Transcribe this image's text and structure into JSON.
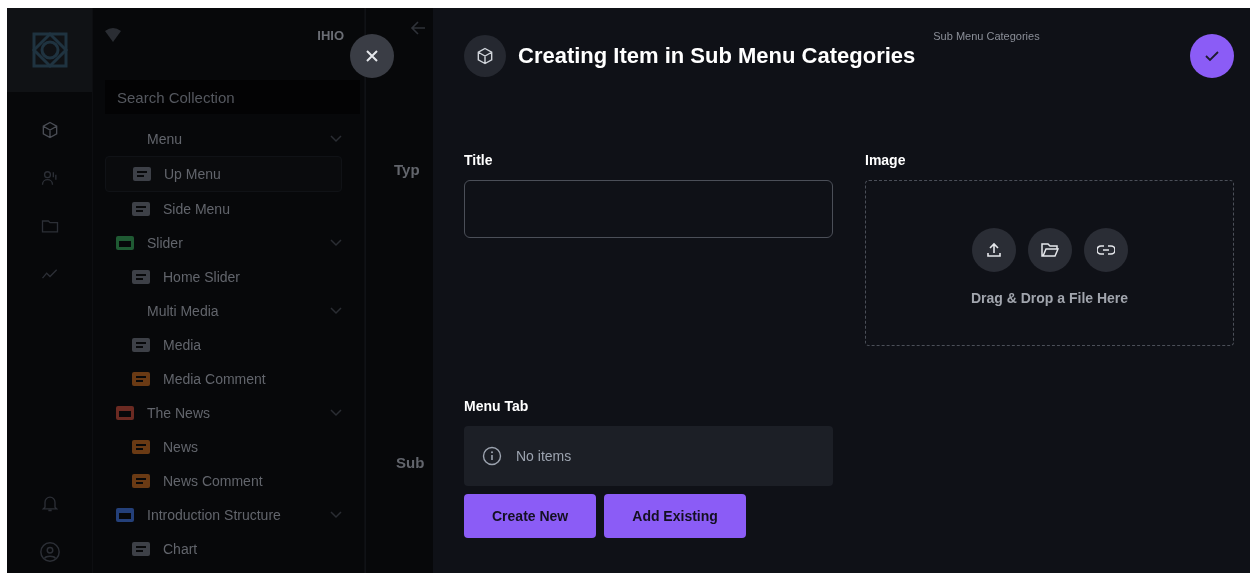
{
  "background": {
    "brand": "IHIO",
    "search": {
      "placeholder": "Search Collection"
    },
    "sidebar": [
      {
        "label": "Menu",
        "expanded": true,
        "children": [
          {
            "label": "Up Menu",
            "selected": true,
            "color": "#3d4047"
          },
          {
            "label": "Side Menu",
            "selected": false,
            "color": "#3d4047"
          }
        ]
      },
      {
        "label": "Slider",
        "expanded": true,
        "color": "#1f5a33",
        "children": [
          {
            "label": "Home Slider",
            "selected": false,
            "color": "#3d4047"
          }
        ]
      },
      {
        "label": "Multi Media",
        "expanded": true,
        "children": [
          {
            "label": "Media",
            "selected": false,
            "color": "#3d4047"
          },
          {
            "label": "Media Comment",
            "selected": false,
            "color": "#6a3a14"
          }
        ]
      },
      {
        "label": "The News",
        "expanded": true,
        "color": "#6b2a22",
        "children": [
          {
            "label": "News",
            "selected": false,
            "color": "#6a3a14"
          },
          {
            "label": "News Comment",
            "selected": false,
            "color": "#6a3a14"
          }
        ]
      },
      {
        "label": "Introduction Structure",
        "expanded": true,
        "color": "#24407a",
        "children": [
          {
            "label": "Chart",
            "selected": false,
            "color": "#3d4047"
          }
        ]
      }
    ],
    "content_labels": [
      "Typ",
      "Sub"
    ]
  },
  "drawer": {
    "title": "Creating Item in Sub Menu Categories",
    "collection": "Sub Menu Categories",
    "fields": [
      {
        "label": "Title",
        "kind": "text"
      },
      {
        "label": "Image",
        "kind": "file",
        "hint": "Drag & Drop a File Here"
      }
    ],
    "menu_tab": {
      "label": "Menu Tab",
      "empty_text": "No items",
      "buttons": [
        "Create New",
        "Add Existing"
      ]
    }
  }
}
